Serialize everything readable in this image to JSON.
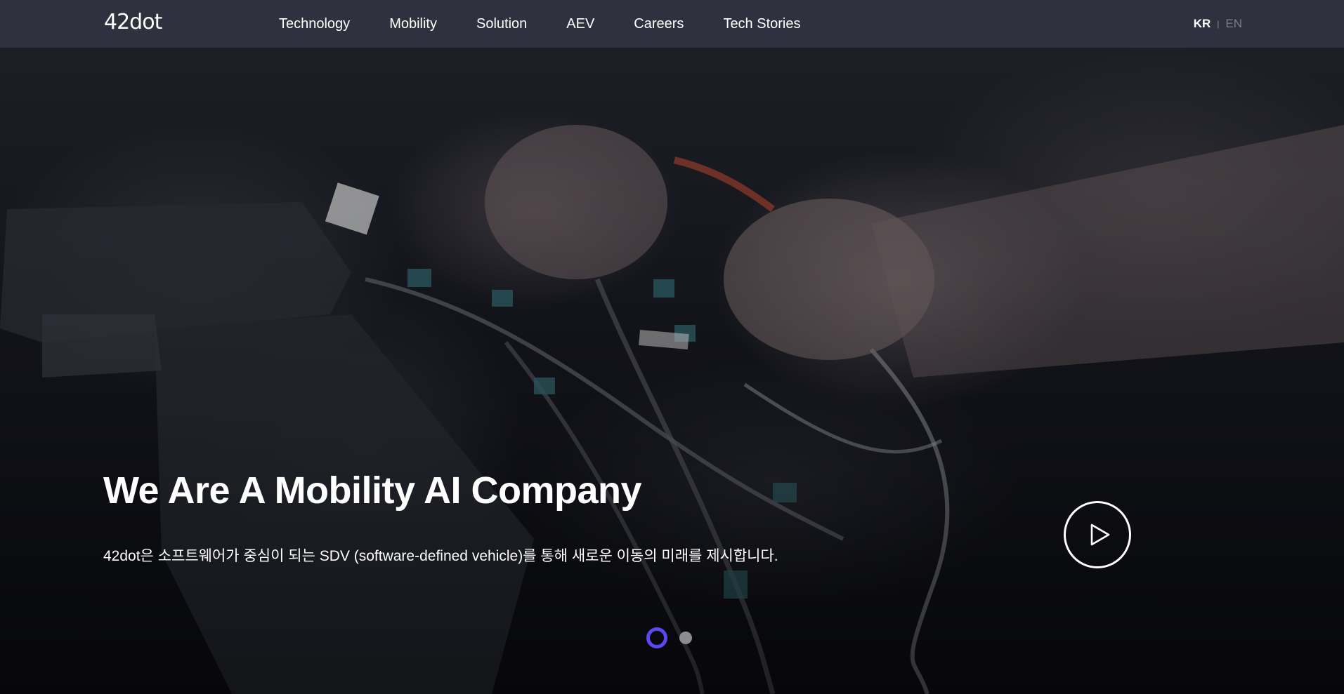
{
  "header": {
    "logo": "42dot",
    "nav": [
      {
        "label": "Technology"
      },
      {
        "label": "Mobility"
      },
      {
        "label": "Solution"
      },
      {
        "label": "AEV"
      },
      {
        "label": "Careers"
      },
      {
        "label": "Tech Stories"
      }
    ],
    "language": {
      "kr": "KR",
      "separator": "|",
      "en": "EN",
      "active": "KR"
    }
  },
  "hero": {
    "title": "We Are A Mobility AI Company",
    "subtitle": "42dot은 소프트웨어가 중심이 되는 SDV (software-defined vehicle)를 통해 새로운 이동의 미래를 제시합니다.",
    "play_icon": "play-icon",
    "slides": {
      "total": 2,
      "current": 1
    }
  },
  "colors": {
    "header_bg": "#2f323e",
    "accent": "#5b48f2",
    "inactive_dot": "#8c8d93",
    "lang_inactive": "#7b7e89"
  }
}
